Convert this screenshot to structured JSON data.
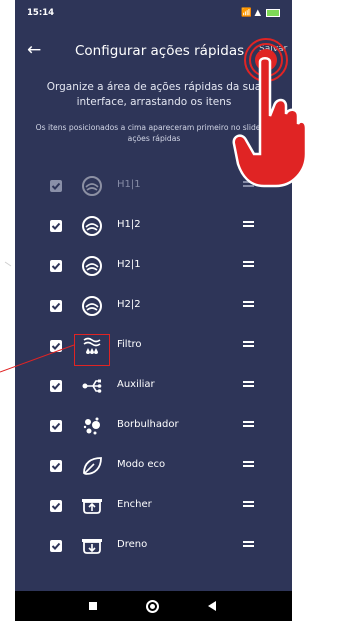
{
  "status": {
    "time": "15:14",
    "icons": "📶 ▲"
  },
  "appbar": {
    "title": "Configurar ações rápidas",
    "save_label": "Salvar"
  },
  "instructions": {
    "main": "Organize a área de ações rápidas da sua interface, arrastando os itens",
    "sub": "Os itens posicionados a cima apareceram primeiro no slide de ações rápidas"
  },
  "items": [
    {
      "label": "H1|1",
      "icon": "spa-icon",
      "checked": true,
      "disabled": true
    },
    {
      "label": "H1|2",
      "icon": "spa-icon",
      "checked": true,
      "disabled": false
    },
    {
      "label": "H2|1",
      "icon": "spa-icon",
      "checked": true,
      "disabled": false
    },
    {
      "label": "H2|2",
      "icon": "spa-icon",
      "checked": true,
      "disabled": false
    },
    {
      "label": "Filtro",
      "icon": "filter-icon",
      "checked": true,
      "disabled": false
    },
    {
      "label": "Auxiliar",
      "icon": "auxiliary-icon",
      "checked": true,
      "disabled": false
    },
    {
      "label": "Borbulhador",
      "icon": "bubbles-icon",
      "checked": true,
      "disabled": false
    },
    {
      "label": "Modo eco",
      "icon": "leaf-icon",
      "checked": true,
      "disabled": false
    },
    {
      "label": "Encher",
      "icon": "fill-icon",
      "checked": true,
      "disabled": false
    },
    {
      "label": "Dreno",
      "icon": "drain-icon",
      "checked": true,
      "disabled": false
    }
  ],
  "colors": {
    "background": "#2e3558",
    "annotation": "#e02424",
    "text": "#ffffff",
    "disabled_text": "#868ca6"
  }
}
